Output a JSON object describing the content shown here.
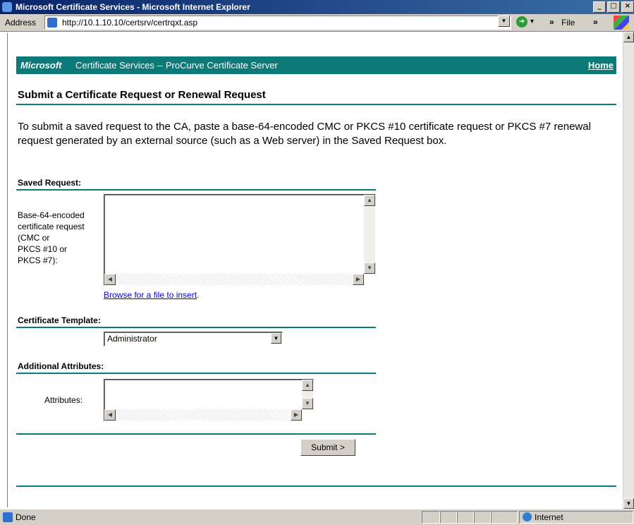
{
  "window": {
    "title": "Microsoft Certificate Services - Microsoft Internet Explorer",
    "controls": [
      "_",
      "□",
      "×"
    ]
  },
  "toolbar": {
    "address_label": "Address",
    "url": "http://10.1.10.10/certsrv/certrqxt.asp",
    "chevron": "»",
    "menu_file": "File"
  },
  "banner": {
    "brand": "Microsoft",
    "rest": "Certificate Services  --  ProCurve Certificate Server",
    "home": "Home"
  },
  "page": {
    "title": "Submit a Certificate Request or Renewal Request",
    "intro": "To submit a saved request to the CA, paste a base-64-encoded CMC or PKCS #10 certificate request or PKCS #7 renewal request generated by an external source (such as a Web server) in the Saved Request box."
  },
  "saved_request": {
    "heading": "Saved Request:",
    "label_lines": [
      "Base-64-encoded",
      "certificate request",
      "(CMC or",
      "PKCS #10 or",
      "PKCS #7):"
    ],
    "value": "",
    "browse_link": "Browse for a file to insert",
    "browse_suffix": "."
  },
  "template": {
    "heading": "Certificate Template:",
    "selected": "Administrator"
  },
  "attributes": {
    "heading": "Additional Attributes:",
    "label": "Attributes:",
    "value": ""
  },
  "submit_label": "Submit >",
  "status": {
    "text": "Done",
    "zone": "Internet"
  },
  "colors": {
    "accent": "#0b7a79",
    "link": "#0000ee",
    "chrome": "#d4d0c8"
  }
}
